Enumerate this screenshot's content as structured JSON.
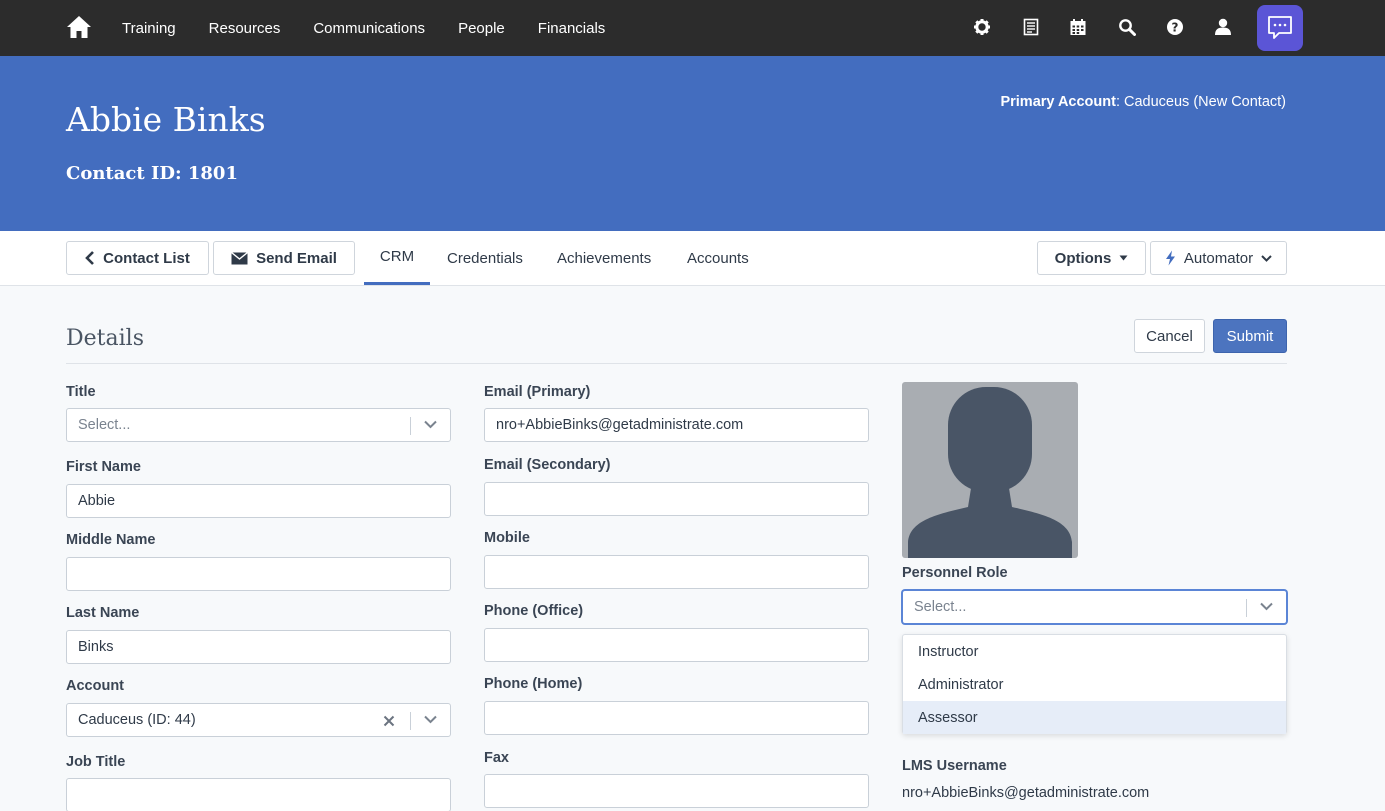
{
  "nav": {
    "links": [
      "Training",
      "Resources",
      "Communications",
      "People",
      "Financials"
    ],
    "icons": [
      "gear-icon",
      "document-icon",
      "calendar-icon",
      "search-icon",
      "help-icon",
      "user-icon",
      "chat-icon"
    ],
    "colors": {
      "bar": "#2c2c2c",
      "chat_button": "#5b55d6"
    }
  },
  "header": {
    "name": "Abbie Binks",
    "contact_id": "Contact ID: 1801",
    "primary_account_label": "Primary Account",
    "primary_account_value": ": Caduceus (New Contact)",
    "color": "#436dbf"
  },
  "toolbar": {
    "contact_list": "Contact List",
    "send_email": "Send Email",
    "tabs": [
      "CRM",
      "Credentials",
      "Achievements",
      "Accounts"
    ],
    "active_tab": "CRM",
    "options": "Options",
    "automator": "Automator"
  },
  "details": {
    "title": "Details",
    "cancel": "Cancel",
    "submit": "Submit",
    "left": {
      "title_label": "Title",
      "title_placeholder": "Select...",
      "first_name_label": "First Name",
      "first_name_value": "Abbie",
      "middle_name_label": "Middle Name",
      "middle_name_value": "",
      "last_name_label": "Last Name",
      "last_name_value": "Binks",
      "account_label": "Account",
      "account_value": "Caduceus (ID: 44)",
      "job_title_label": "Job Title",
      "job_title_value": ""
    },
    "middle": {
      "email_primary_label": "Email (Primary)",
      "email_primary_value": "nro+AbbieBinks@getadministrate.com",
      "email_secondary_label": "Email (Secondary)",
      "mobile_label": "Mobile",
      "phone_office_label": "Phone (Office)",
      "phone_home_label": "Phone (Home)",
      "fax_label": "Fax"
    },
    "right": {
      "personnel_role_label": "Personnel Role",
      "personnel_role_placeholder": "Select...",
      "role_options": [
        "Instructor",
        "Administrator",
        "Assessor"
      ],
      "highlighted_option": "Assessor",
      "lms_username_label": "LMS Username",
      "lms_username_value": "nro+AbbieBinks@getadministrate.com"
    }
  }
}
